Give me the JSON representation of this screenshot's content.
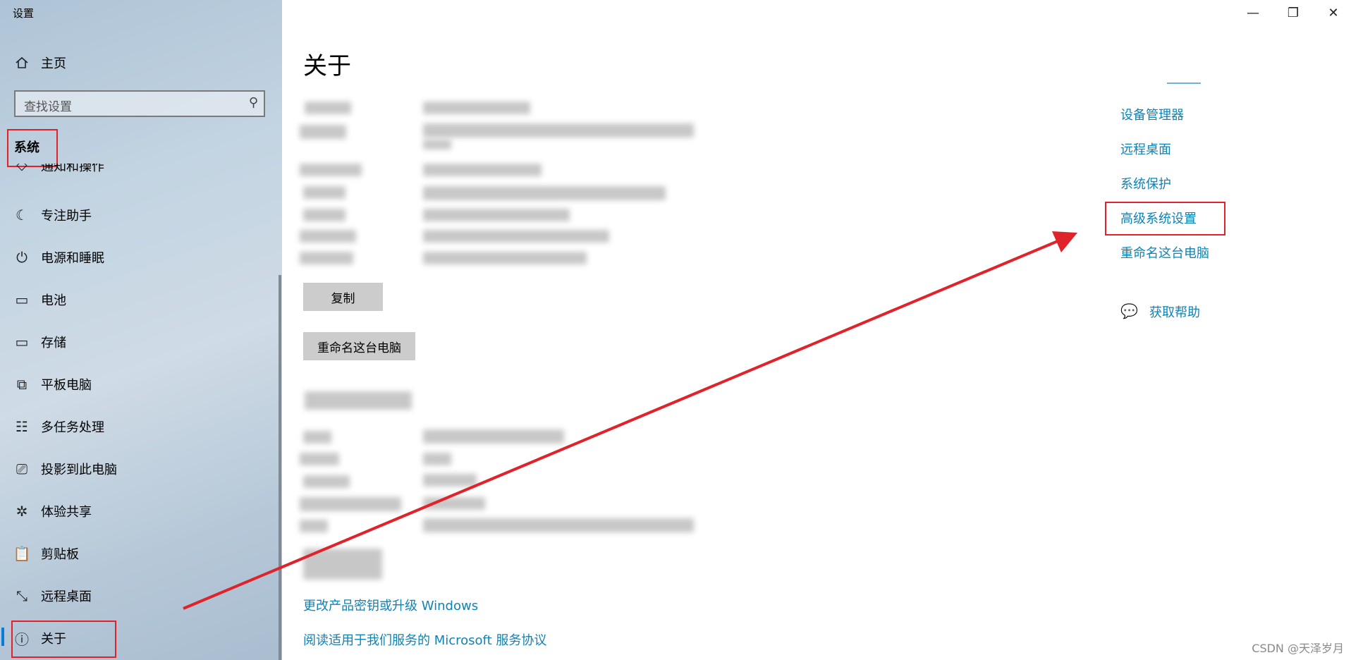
{
  "window": {
    "title": "设置",
    "minimize": "—",
    "restore": "❐",
    "close": "✕"
  },
  "sidebar": {
    "home": {
      "label": "主页",
      "icon": "home-icon"
    },
    "search": {
      "placeholder": "查找设置",
      "icon": "search-icon"
    },
    "section": "系统",
    "partial_item": "通知和操作",
    "items": [
      {
        "label": "专注助手",
        "icon": "moon-icon"
      },
      {
        "label": "电源和睡眠",
        "icon": "power-icon"
      },
      {
        "label": "电池",
        "icon": "battery-icon"
      },
      {
        "label": "存储",
        "icon": "storage-icon"
      },
      {
        "label": "平板电脑",
        "icon": "tablet-icon"
      },
      {
        "label": "多任务处理",
        "icon": "multitask-icon"
      },
      {
        "label": "投影到此电脑",
        "icon": "project-icon"
      },
      {
        "label": "体验共享",
        "icon": "share-icon"
      },
      {
        "label": "剪贴板",
        "icon": "clipboard-icon"
      },
      {
        "label": "远程桌面",
        "icon": "remote-icon"
      },
      {
        "label": "关于",
        "icon": "info-icon"
      }
    ]
  },
  "main": {
    "title": "关于",
    "copy_button": "复制",
    "rename_button": "重命名这台电脑",
    "links": {
      "upgrade": "更改产品密钥或升级 Windows",
      "agreement": "阅读适用于我们服务的 Microsoft 服务协议"
    }
  },
  "related": {
    "items": [
      "设备管理器",
      "远程桌面",
      "系统保护",
      "高级系统设置",
      "重命名这台电脑"
    ],
    "help": "获取帮助"
  },
  "watermark": "CSDN @天泽岁月",
  "colors": {
    "link": "#0f83b3",
    "highlight": "#e0222a",
    "accent": "#0a7bd6"
  }
}
